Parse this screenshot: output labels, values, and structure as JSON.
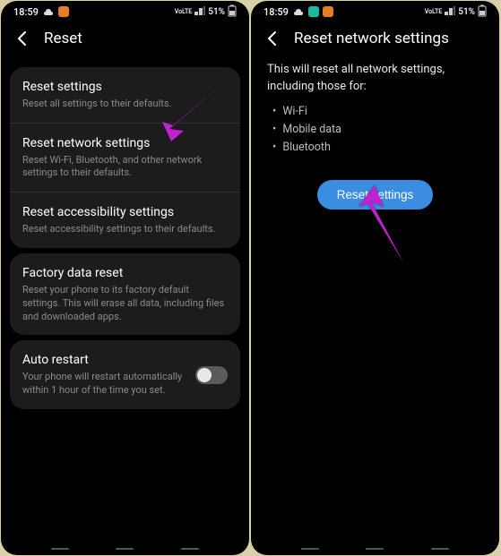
{
  "status": {
    "time": "18:59",
    "volte": "VoLTE",
    "signal": "▮▯",
    "battery_pct": "51%"
  },
  "screen1": {
    "title": "Reset",
    "items": {
      "reset_settings": {
        "title": "Reset settings",
        "sub": "Reset all settings to their defaults."
      },
      "reset_network": {
        "title": "Reset network settings",
        "sub": "Reset Wi-Fi, Bluetooth, and other network settings to their defaults."
      },
      "reset_a11y": {
        "title": "Reset accessibility settings",
        "sub": "Reset accessibility settings to their defaults."
      },
      "factory": {
        "title": "Factory data reset",
        "sub": "Reset your phone to its factory default settings. This will erase all data, including files and downloaded apps."
      },
      "auto_restart": {
        "title": "Auto restart",
        "sub": "Your phone will restart automatically within 1 hour of the time you set."
      }
    }
  },
  "screen2": {
    "title": "Reset network settings",
    "intro": "This will reset all network settings, including those for:",
    "bullets": {
      "b0": "Wi-Fi",
      "b1": "Mobile data",
      "b2": "Bluetooth"
    },
    "button": "Reset settings"
  }
}
